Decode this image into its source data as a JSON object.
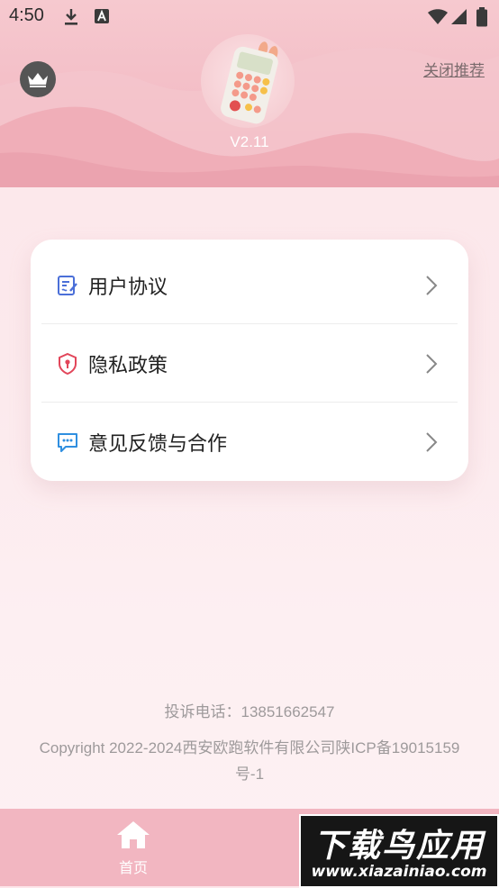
{
  "status_bar": {
    "time": "4:50"
  },
  "header": {
    "close_recommend_label": "关闭推荐",
    "version": "V2.11"
  },
  "menu": {
    "items": [
      {
        "label": "用户协议",
        "icon": "document-edit-icon"
      },
      {
        "label": "隐私政策",
        "icon": "shield-lock-icon"
      },
      {
        "label": "意见反馈与合作",
        "icon": "chat-bubble-icon"
      }
    ]
  },
  "footer": {
    "complaint": "投诉电话：13851662547",
    "copyright": "Copyright 2022-2024西安欧跑软件有限公司陕ICP备19015159号-1"
  },
  "tabbar": {
    "home_label": "首页"
  },
  "watermark": {
    "title": "下载鸟应用",
    "url": "www.xiazainiao.com"
  },
  "colors": {
    "header_pink": "#f3bdc6",
    "tabbar_pink": "#f2b6c1",
    "icon_blue": "#4b6fd8",
    "icon_red": "#e2465a",
    "icon_cyan": "#2f8fe0"
  }
}
